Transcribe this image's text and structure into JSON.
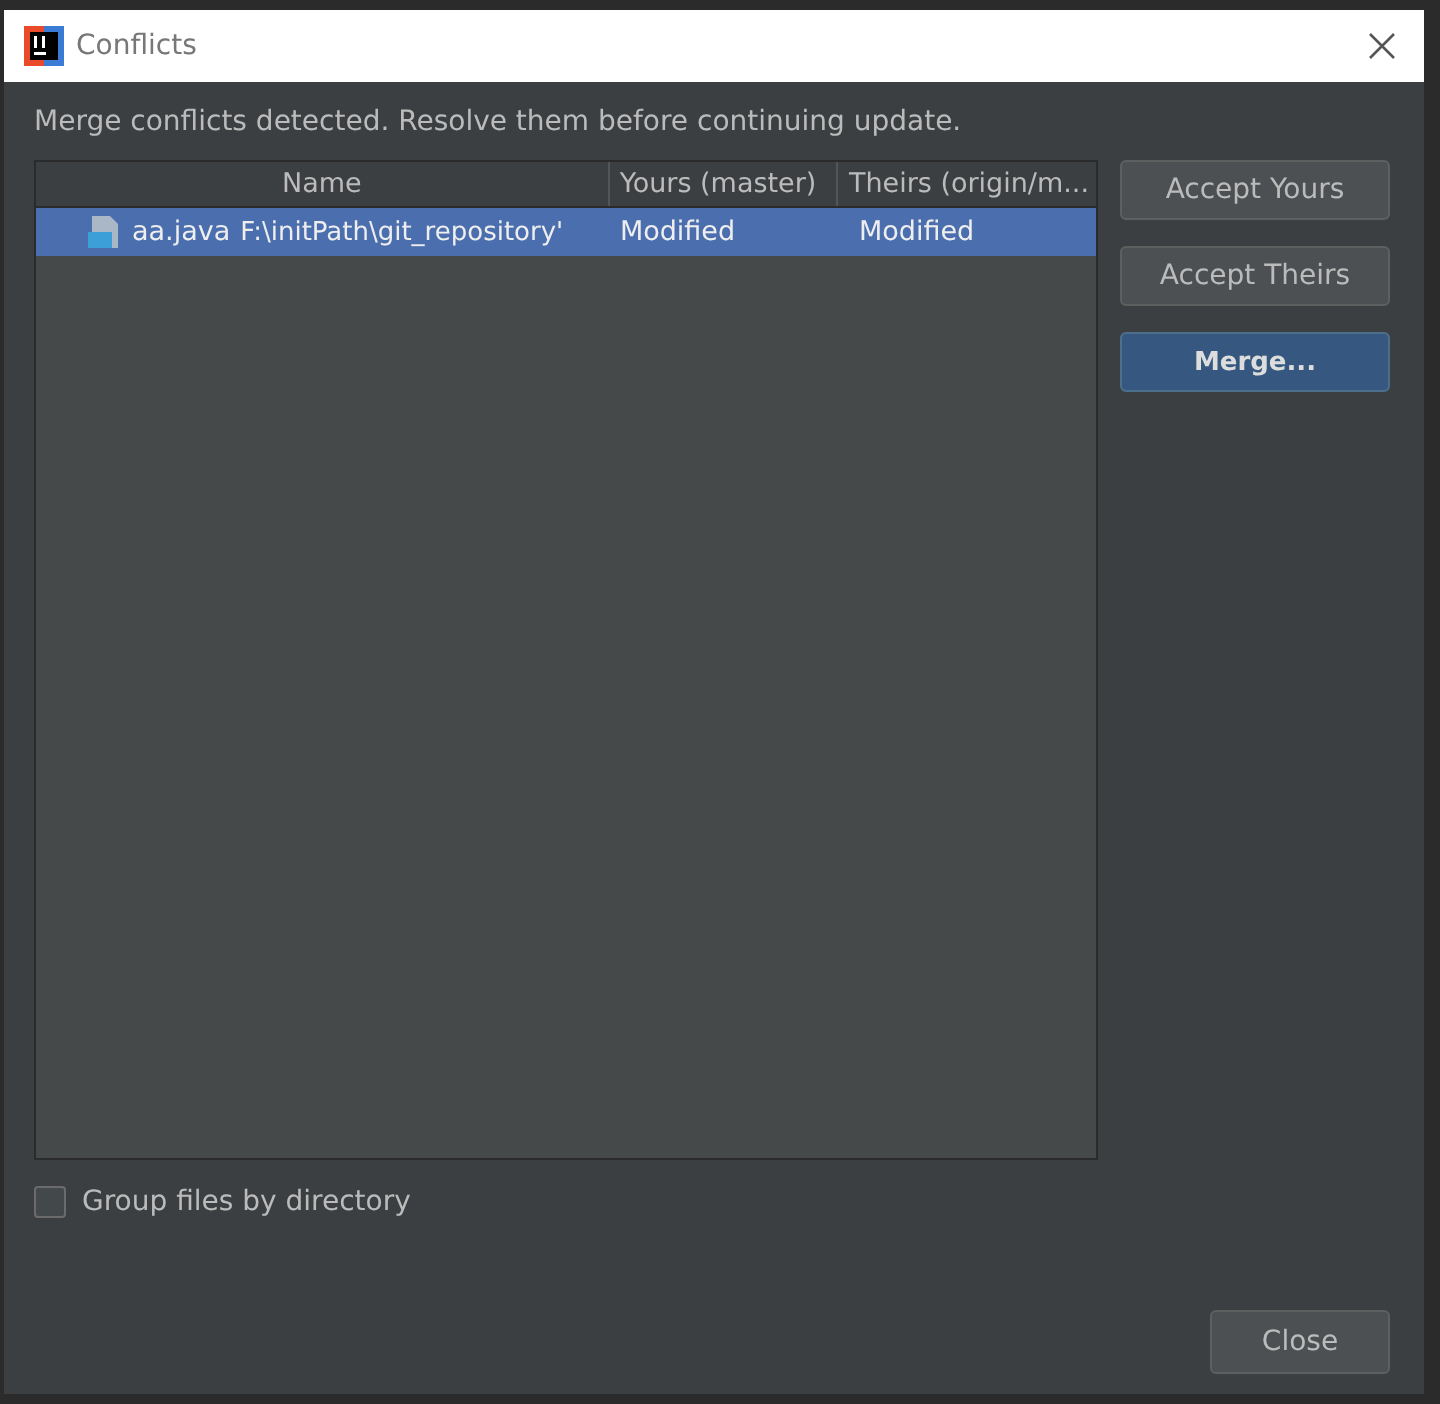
{
  "window": {
    "title": "Conflicts"
  },
  "message": "Merge conflicts detected. Resolve them before continuing update.",
  "table": {
    "columns": [
      "Name",
      "Yours (master)",
      "Theirs (origin/m..."
    ],
    "rows": [
      {
        "file": "aa.java",
        "path": "F:\\initPath\\git_repository'",
        "yours": "Modified",
        "theirs": "Modified",
        "selected": true
      }
    ]
  },
  "actions": [
    {
      "label": "Accept Yours",
      "default": false
    },
    {
      "label": "Accept Theirs",
      "default": false
    },
    {
      "label": "Merge...",
      "default": true
    }
  ],
  "group_by_directory": {
    "label": "Group files by directory",
    "checked": false
  },
  "close_button": "Close"
}
